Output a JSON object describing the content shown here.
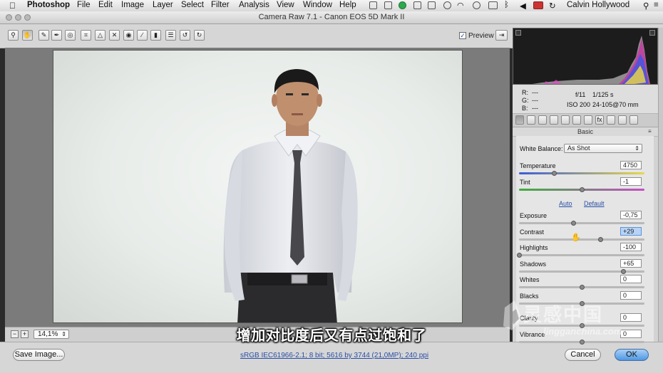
{
  "menubar": {
    "app_name": "Photoshop",
    "menus": [
      "File",
      "Edit",
      "Image",
      "Layer",
      "Select",
      "Filter",
      "Analysis",
      "View",
      "Window",
      "Help"
    ],
    "user_name": "Calvin Hollywood"
  },
  "window": {
    "title": "Camera Raw 7.1  -  Canon EOS 5D Mark II"
  },
  "toolbar": {
    "tools": [
      "zoom-tool",
      "hand-tool",
      "white-balance-tool",
      "color-sampler-tool",
      "targeted-adjustment-tool",
      "crop-tool",
      "straighten-tool",
      "spot-removal-tool",
      "red-eye-removal-tool",
      "adjustment-brush-tool",
      "graduated-filter-tool",
      "preferences-button",
      "rotate-ccw-button",
      "rotate-cw-button"
    ],
    "preview_label": "Preview",
    "preview_checked": true
  },
  "zoom": {
    "value": "14,1%",
    "minus": "−",
    "plus": "+"
  },
  "subtitle": "增加对比度后又有点过饱和了",
  "bottom": {
    "save_label": "Save Image...",
    "workflow_link": "sRGB IEC61966-2.1; 8 bit; 5616 by 3744 (21,0MP); 240 ppi",
    "cancel_label": "Cancel",
    "ok_label": "OK"
  },
  "info": {
    "r_label": "R:",
    "r_value": "---",
    "g_label": "G:",
    "g_value": "---",
    "b_label": "B:",
    "b_value": "---",
    "aperture": "f/11",
    "shutter": "1/125 s",
    "iso": "ISO 200",
    "lens": "24-105@70 mm"
  },
  "panel": {
    "section_title": "Basic",
    "white_balance_label": "White Balance:",
    "white_balance_value": "As Shot",
    "auto_label": "Auto",
    "default_label": "Default",
    "sliders": [
      {
        "name": "temperature",
        "label": "Temperature",
        "value": "4750",
        "pos": 0.28
      },
      {
        "name": "tint",
        "label": "Tint",
        "value": "-1",
        "pos": 0.5
      },
      {
        "name": "exposure",
        "label": "Exposure",
        "value": "-0,75",
        "pos": 0.43
      },
      {
        "name": "contrast",
        "label": "Contrast",
        "value": "+29",
        "pos": 0.65
      },
      {
        "name": "highlights",
        "label": "Highlights",
        "value": "-100",
        "pos": 0.0
      },
      {
        "name": "shadows",
        "label": "Shadows",
        "value": "+65",
        "pos": 0.83
      },
      {
        "name": "whites",
        "label": "Whites",
        "value": "0",
        "pos": 0.5
      },
      {
        "name": "blacks",
        "label": "Blacks",
        "value": "0",
        "pos": 0.5
      },
      {
        "name": "clarity",
        "label": "Clarity",
        "value": "0",
        "pos": 0.5
      },
      {
        "name": "vibrance",
        "label": "Vibrance",
        "value": "0",
        "pos": 0.5
      }
    ]
  },
  "watermark": {
    "brand": "灵感中国",
    "url": "lingganchina.com"
  },
  "colors": {
    "ok_button": "#4f97e3",
    "link": "#2a4fa6",
    "temperature_gradient": [
      "#3b5bd6",
      "#e8d84a"
    ],
    "tint_gradient": [
      "#3fae3f",
      "#c54fc5"
    ]
  }
}
